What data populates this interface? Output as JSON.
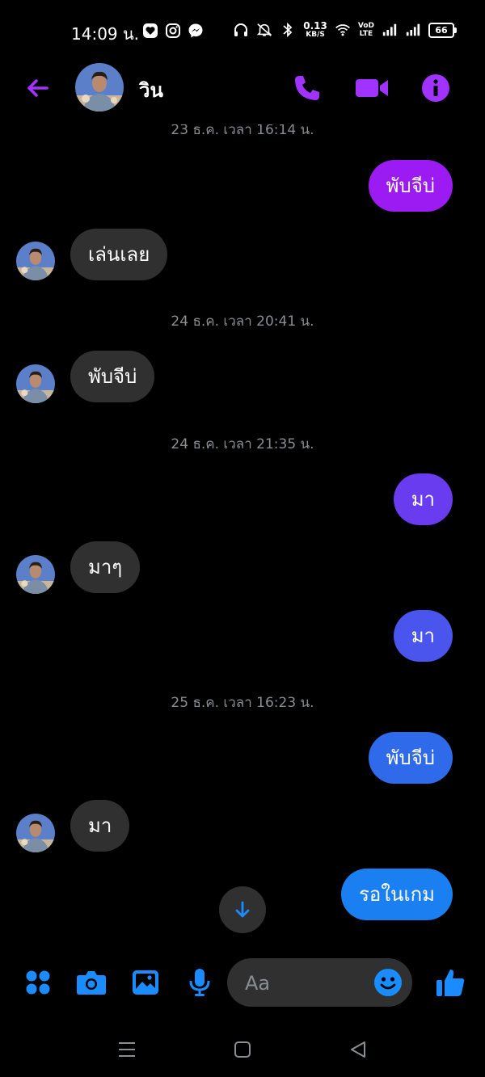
{
  "status_bar": {
    "time": "14:09 น.",
    "net_speed_value": "0.13",
    "net_speed_unit": "KB/S",
    "volte_top": "VoD",
    "volte_bottom": "LTE",
    "battery": "66"
  },
  "header": {
    "contact_name": "วิน",
    "accent_color": "#a033ff"
  },
  "messages": [
    {
      "type": "timestamp",
      "text": "23 ธ.ค. เวลา 16:14 น."
    },
    {
      "type": "out",
      "text": "พับจีบ่",
      "color": "#9b1bf2"
    },
    {
      "type": "in",
      "text": "เล่นเลย"
    },
    {
      "type": "timestamp",
      "text": "24 ธ.ค. เวลา 20:41 น."
    },
    {
      "type": "in",
      "text": "พับจีบ่"
    },
    {
      "type": "timestamp",
      "text": "24 ธ.ค. เวลา 21:35 น."
    },
    {
      "type": "out",
      "text": "มา",
      "color": "#6a3cf0"
    },
    {
      "type": "in",
      "text": "มาๆ"
    },
    {
      "type": "out",
      "text": "มา",
      "color": "#4a55ee"
    },
    {
      "type": "timestamp",
      "text": "25 ธ.ค. เวลา 16:23 น."
    },
    {
      "type": "out",
      "text": "พับจีบ่",
      "color": "#2f6aea"
    },
    {
      "type": "in",
      "text": "มา"
    },
    {
      "type": "out",
      "text": "รอในเกม",
      "color": "#1a7ff0"
    }
  ],
  "composer": {
    "placeholder": "Aa",
    "icon_color": "#1a8cff",
    "icons": [
      "apps-icon",
      "camera-icon",
      "gallery-icon",
      "microphone-icon",
      "emoji-icon",
      "like-icon"
    ]
  }
}
